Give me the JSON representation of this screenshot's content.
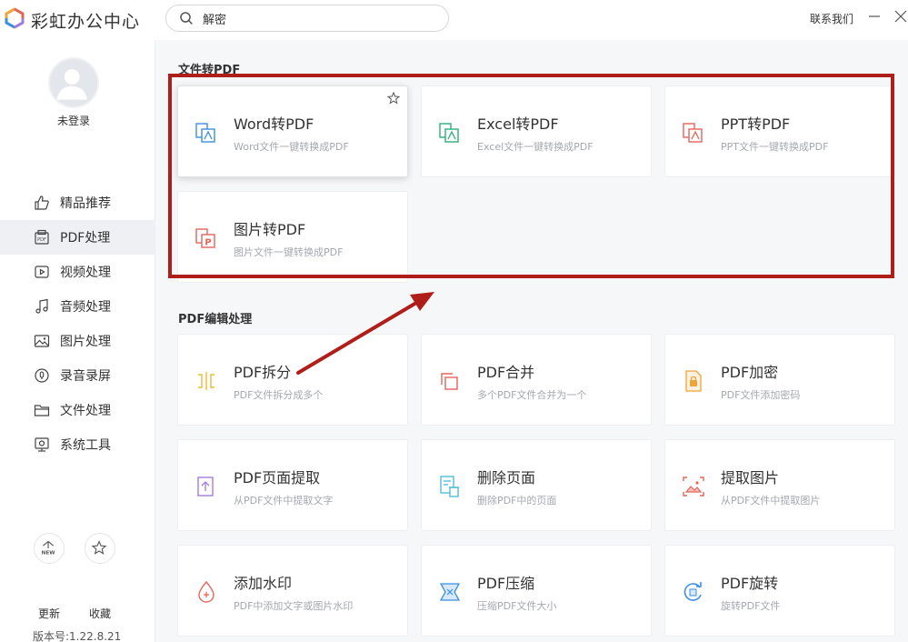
{
  "app": {
    "title": "彩虹办公中心",
    "contact": "联系我们"
  },
  "search": {
    "value": "解密"
  },
  "user": {
    "status": "未登录"
  },
  "sidebar": {
    "items": [
      {
        "label": "精品推荐",
        "icon": "thumbs-up-icon"
      },
      {
        "label": "PDF处理",
        "icon": "pdf-icon",
        "active": true
      },
      {
        "label": "视频处理",
        "icon": "video-icon"
      },
      {
        "label": "音频处理",
        "icon": "music-icon"
      },
      {
        "label": "图片处理",
        "icon": "image-icon"
      },
      {
        "label": "录音录屏",
        "icon": "record-icon"
      },
      {
        "label": "文件处理",
        "icon": "folder-icon"
      },
      {
        "label": "系统工具",
        "icon": "system-icon"
      }
    ],
    "update_label": "更新",
    "update_badge": "NEW",
    "favorites_label": "收藏",
    "version": "版本号:1.22.8.21"
  },
  "sections": [
    {
      "title": "文件转PDF",
      "cards": [
        {
          "title": "Word转PDF",
          "desc": "Word文件一键转换成PDF",
          "icon": "word-to-pdf-icon",
          "color": "#3b8fe0"
        },
        {
          "title": "Excel转PDF",
          "desc": "Excel文件一键转换成PDF",
          "icon": "excel-to-pdf-icon",
          "color": "#2eae7a"
        },
        {
          "title": "PPT转PDF",
          "desc": "PPT文件一键转换成PDF",
          "icon": "ppt-to-pdf-icon",
          "color": "#e5645a"
        },
        {
          "title": "图片转PDF",
          "desc": "图片文件一键转换成PDF",
          "icon": "image-to-pdf-icon",
          "color": "#e5645a"
        }
      ]
    },
    {
      "title": "PDF编辑处理",
      "cards": [
        {
          "title": "PDF拆分",
          "desc": "PDF文件拆分成多个",
          "icon": "split-icon",
          "color": "#f0b93a"
        },
        {
          "title": "PDF合并",
          "desc": "多个PDF文件合并为一个",
          "icon": "merge-icon",
          "color": "#e5645a"
        },
        {
          "title": "PDF加密",
          "desc": "PDF文件添加密码",
          "icon": "lock-file-icon",
          "color": "#f0a33a"
        },
        {
          "title": "PDF页面提取",
          "desc": "从PDF文件中提取文字",
          "icon": "extract-page-icon",
          "color": "#a37be0"
        },
        {
          "title": "删除页面",
          "desc": "删除PDF中的页面",
          "icon": "delete-page-icon",
          "color": "#45b8d6"
        },
        {
          "title": "提取图片",
          "desc": "从PDF文件中提取图片",
          "icon": "extract-image-icon",
          "color": "#e5645a"
        },
        {
          "title": "添加水印",
          "desc": "PDF中添加文字或图片水印",
          "icon": "watermark-icon",
          "color": "#e5645a"
        },
        {
          "title": "PDF压缩",
          "desc": "压缩PDF文件大小",
          "icon": "compress-icon",
          "color": "#3b8fe0"
        },
        {
          "title": "PDF旋转",
          "desc": "旋转PDF文件",
          "icon": "rotate-icon",
          "color": "#3b8fe0"
        }
      ]
    }
  ],
  "annotation": {
    "box_color": "#b01e1a",
    "arrow_color": "#b01e1a"
  }
}
